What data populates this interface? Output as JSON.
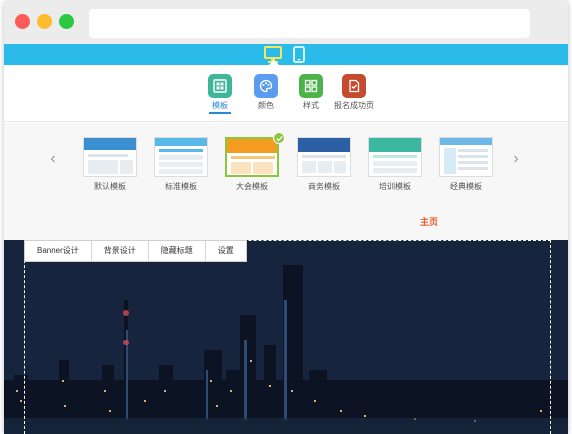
{
  "window": {
    "controls": [
      "close",
      "minimize",
      "zoom"
    ]
  },
  "device_bar": {
    "color": "#2bbbea",
    "devices": [
      {
        "icon": "desktop-icon",
        "active": true
      },
      {
        "icon": "mobile-icon",
        "active": false
      }
    ]
  },
  "tabs": [
    {
      "label": "模板",
      "icon": "template-icon",
      "color": "#3fb59a",
      "active": true
    },
    {
      "label": "颜色",
      "icon": "palette-icon",
      "color": "#5b9cf0",
      "active": false
    },
    {
      "label": "样式",
      "icon": "style-grid-icon",
      "color": "#4db24a",
      "active": false
    },
    {
      "label": "报名成功页",
      "icon": "success-page-icon",
      "color": "#c64a2e",
      "active": false
    }
  ],
  "templates": [
    {
      "label": "默认模板",
      "band": "#3a8fd0",
      "selected": false
    },
    {
      "label": "标准模板",
      "band": "#58b8e8",
      "selected": false
    },
    {
      "label": "大会模板",
      "band": "#f39c1f",
      "selected": true
    },
    {
      "label": "商务模板",
      "band": "#2b5fa6",
      "selected": false
    },
    {
      "label": "培训模板",
      "band": "#3db8a0",
      "selected": false
    },
    {
      "label": "经典模板",
      "band": "#6cb8e6",
      "selected": false
    }
  ],
  "page_nav": {
    "home": "主页",
    "color": "#f05a28"
  },
  "banner_toolbar": {
    "banner_design": "Banner设计",
    "background_design": "背景设计",
    "hide_title": "隐藏标题",
    "settings": "设置"
  }
}
